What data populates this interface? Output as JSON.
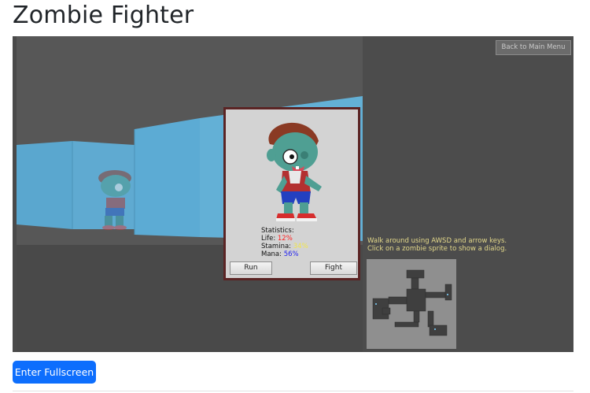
{
  "page": {
    "title": "Zombie Fighter"
  },
  "game": {
    "back_button_label": "Back to Main Menu",
    "dialog": {
      "stats_heading": "Statistics:",
      "life_label": "Life:",
      "life_value": "12%",
      "stamina_label": "Stamina:",
      "stamina_value": "34%",
      "mana_label": "Mana:",
      "mana_value": "56%",
      "run_label": "Run",
      "fight_label": "Fight"
    },
    "instructions": {
      "line1": "Walk around using AWSD and arrow keys.",
      "line2": "Click on a zombie sprite to show a dialog."
    },
    "colors": {
      "wall": "#5aa7cf",
      "floor": "#4a4a4a",
      "sky": "#585858",
      "dialog_border": "#5b2424",
      "life": "#ff2020",
      "stamina": "#f2e648",
      "mana": "#1e1ef0"
    }
  },
  "actions": {
    "fullscreen_label": "Enter Fullscreen"
  }
}
